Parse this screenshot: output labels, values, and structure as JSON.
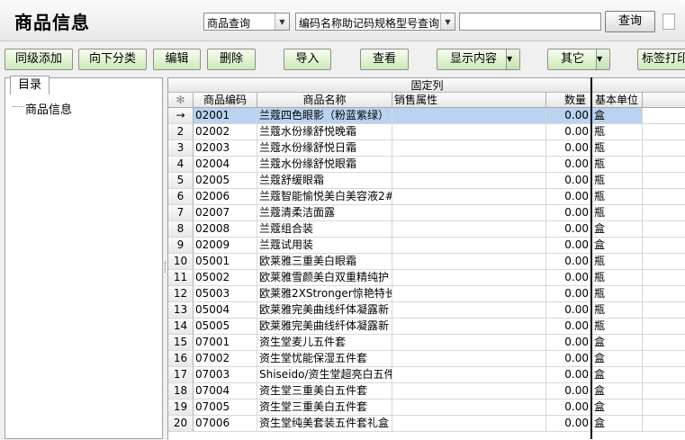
{
  "header": {
    "title": "商品信息",
    "query_select": "商品查询",
    "field_select": "编码名称助记码规格型号查询",
    "search_value": "",
    "search_button": "查询"
  },
  "toolbar": {
    "add_sibling": "同级添加",
    "add_child": "向下分类",
    "edit": "编辑",
    "delete": "删除",
    "import": "导入",
    "view": "查看",
    "display_content": "显示内容",
    "other": "其它",
    "label_print": "标签打印"
  },
  "tree": {
    "tab": "目录",
    "root": "商品信息"
  },
  "grid": {
    "fixed_header": "固定列",
    "corner": "✻",
    "columns": [
      "商品编码",
      "商品名称",
      "销售属性",
      "数量",
      "基本单位"
    ],
    "current_marker": "→",
    "rows": [
      {
        "n": "1",
        "code": "02001",
        "name": "兰蔻四色眼影（粉蓝紫绿）",
        "qty": "0.00",
        "unit": "盒"
      },
      {
        "n": "2",
        "code": "02002",
        "name": "兰蔻水份缘舒悦晚霜",
        "qty": "0.00",
        "unit": "瓶"
      },
      {
        "n": "3",
        "code": "02003",
        "name": "兰蔻水份缘舒悦日霜",
        "qty": "0.00",
        "unit": "瓶"
      },
      {
        "n": "4",
        "code": "02004",
        "name": "兰蔻水份缘舒悦眼霜",
        "qty": "0.00",
        "unit": "瓶"
      },
      {
        "n": "5",
        "code": "02005",
        "name": "兰蔻舒缓眼霜",
        "qty": "0.00",
        "unit": "瓶"
      },
      {
        "n": "6",
        "code": "02006",
        "name": "兰蔻智能愉悦美白美容液2#",
        "qty": "0.00",
        "unit": "瓶"
      },
      {
        "n": "7",
        "code": "02007",
        "name": "兰蔻清柔洁面露",
        "qty": "0.00",
        "unit": "瓶"
      },
      {
        "n": "8",
        "code": "02008",
        "name": "兰蔻组合装",
        "qty": "0.00",
        "unit": "盒"
      },
      {
        "n": "9",
        "code": "02009",
        "name": "兰蔻试用装",
        "qty": "0.00",
        "unit": "盒"
      },
      {
        "n": "10",
        "code": "05001",
        "name": "欧莱雅三重美白眼霜",
        "qty": "0.00",
        "unit": "瓶"
      },
      {
        "n": "11",
        "code": "05002",
        "name": "欧莱雅雪颜美白双重精纯护",
        "qty": "0.00",
        "unit": "瓶"
      },
      {
        "n": "12",
        "code": "05003",
        "name": "欧莱雅2XStronger惊艳特长",
        "qty": "0.00",
        "unit": "瓶"
      },
      {
        "n": "13",
        "code": "05004",
        "name": "欧莱雅完美曲线纤体凝露新",
        "qty": "0.00",
        "unit": "瓶"
      },
      {
        "n": "14",
        "code": "05005",
        "name": "欧莱雅完美曲线纤体凝露新",
        "qty": "0.00",
        "unit": "瓶"
      },
      {
        "n": "15",
        "code": "07001",
        "name": "资生堂麦儿五件套",
        "qty": "0.00",
        "unit": "盒"
      },
      {
        "n": "16",
        "code": "07002",
        "name": "资生堂忧能保湿五件套",
        "qty": "0.00",
        "unit": "盒"
      },
      {
        "n": "17",
        "code": "07003",
        "name": "Shiseido/资生堂超亮白五件",
        "qty": "0.00",
        "unit": "盒"
      },
      {
        "n": "18",
        "code": "07004",
        "name": "资生堂三重美白五件套",
        "qty": "0.00",
        "unit": "盒"
      },
      {
        "n": "19",
        "code": "07005",
        "name": "资生堂三重美白五件套",
        "qty": "0.00",
        "unit": "盒"
      },
      {
        "n": "20",
        "code": "07006",
        "name": "资生堂纯美套装五件套礼盒",
        "qty": "0.00",
        "unit": "盒"
      }
    ]
  }
}
